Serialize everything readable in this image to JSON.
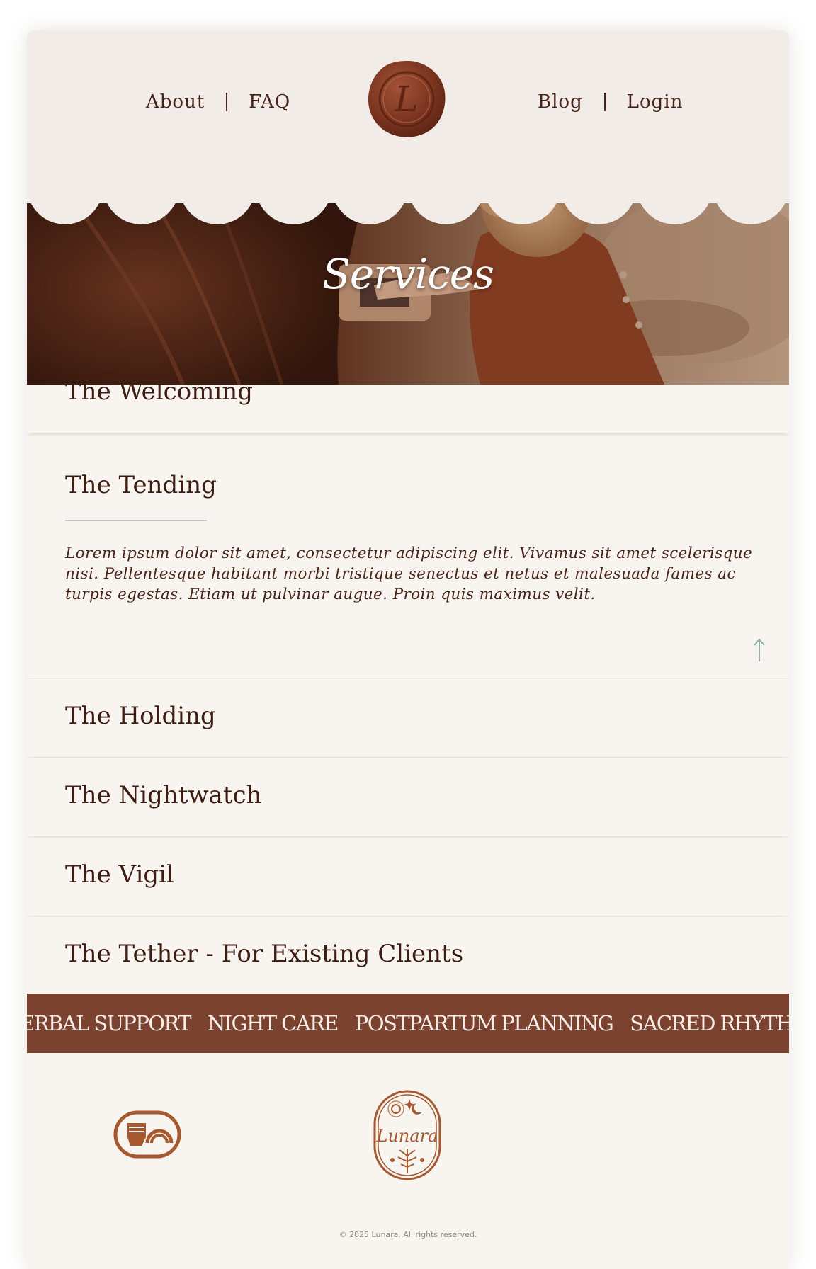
{
  "nav": {
    "left": [
      "About",
      "FAQ"
    ],
    "right": [
      "Blog",
      "Login"
    ],
    "seal_letter": "L"
  },
  "hero": {
    "title": "Services"
  },
  "services": [
    {
      "title": "The Welcoming",
      "expanded": false
    },
    {
      "title": "The Tending",
      "expanded": true,
      "body": "Lorem ipsum dolor sit amet, consectetur adipiscing elit. Vivamus sit amet scelerisque nisi. Pellentesque habitant morbi tristique senectus et netus et malesuada fames ac turpis egestas. Etiam ut pulvinar augue. Proin quis maximus velit."
    },
    {
      "title": "The Holding",
      "expanded": false
    },
    {
      "title": "The Nightwatch",
      "expanded": false
    },
    {
      "title": "The Vigil",
      "expanded": false
    },
    {
      "title": "The Tether - For Existing Clients",
      "expanded": false
    }
  ],
  "banner": [
    "HERBAL SUPPORT",
    "NIGHT CARE",
    "POSTPARTUM PLANNING",
    "SACRED RHYTHM"
  ],
  "footer": {
    "logo_text": "Lunara",
    "copyright": "© 2025 Lunara. All rights reserved."
  },
  "colors": {
    "accent": "#7c4230",
    "text": "#3e1d12",
    "background": "#f8f4f0",
    "header_background": "#f1ece8",
    "divider": "#b8c7c8"
  },
  "icons": [
    "wax-seal-icon",
    "arrow-up-icon",
    "raised-fist-rainbow-icon",
    "lunara-logo"
  ]
}
